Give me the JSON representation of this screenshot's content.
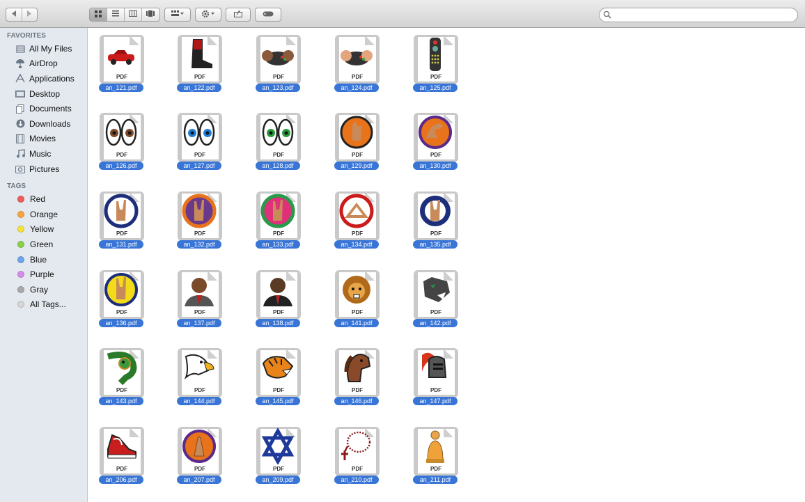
{
  "toolbar": {
    "back_icon": "chevron-left-icon",
    "forward_icon": "chevron-right-icon",
    "views": [
      "icon-view-icon",
      "list-view-icon",
      "column-view-icon",
      "coverflow-view-icon"
    ],
    "arrange_icon": "grid-arrange-icon",
    "action_icon": "gear-icon",
    "share_icon": "share-icon",
    "tags_icon": "tag-icon",
    "search_placeholder": ""
  },
  "sidebar": {
    "favorites_header": "FAVORITES",
    "favorites": [
      {
        "label": "All My Files",
        "icon": "all-files-icon"
      },
      {
        "label": "AirDrop",
        "icon": "airdrop-icon"
      },
      {
        "label": "Applications",
        "icon": "applications-icon"
      },
      {
        "label": "Desktop",
        "icon": "desktop-icon"
      },
      {
        "label": "Documents",
        "icon": "documents-icon"
      },
      {
        "label": "Downloads",
        "icon": "downloads-icon"
      },
      {
        "label": "Movies",
        "icon": "movies-icon"
      },
      {
        "label": "Music",
        "icon": "music-icon"
      },
      {
        "label": "Pictures",
        "icon": "pictures-icon"
      }
    ],
    "tags_header": "TAGS",
    "tags": [
      {
        "label": "Red",
        "color": "#f25c5c"
      },
      {
        "label": "Orange",
        "color": "#f8a541"
      },
      {
        "label": "Yellow",
        "color": "#f5e33d"
      },
      {
        "label": "Green",
        "color": "#8bd04b"
      },
      {
        "label": "Blue",
        "color": "#6ea6ee"
      },
      {
        "label": "Purple",
        "color": "#d48de8"
      },
      {
        "label": "Gray",
        "color": "#a9a9a9"
      },
      {
        "label": "All Tags...",
        "color": "#d6d6d6"
      }
    ]
  },
  "files": [
    {
      "name": "an_121.pdf",
      "icon": "red-car-icon"
    },
    {
      "name": "an_122.pdf",
      "icon": "red-boot-icon"
    },
    {
      "name": "an_123.pdf",
      "icon": "game-controller-dark-hands-icon"
    },
    {
      "name": "an_124.pdf",
      "icon": "game-controller-light-hands-icon"
    },
    {
      "name": "an_125.pdf",
      "icon": "tv-remote-icon"
    },
    {
      "name": "an_126.pdf",
      "icon": "brown-eyes-icon"
    },
    {
      "name": "an_127.pdf",
      "icon": "blue-eyes-icon"
    },
    {
      "name": "an_128.pdf",
      "icon": "green-eyes-icon"
    },
    {
      "name": "an_129.pdf",
      "icon": "hand-sign-orange-circle-icon"
    },
    {
      "name": "an_130.pdf",
      "icon": "flexed-arm-orange-circle-icon"
    },
    {
      "name": "an_131.pdf",
      "icon": "horns-hand-navy-ring-icon"
    },
    {
      "name": "an_132.pdf",
      "icon": "horns-hand-purple-orange-icon"
    },
    {
      "name": "an_133.pdf",
      "icon": "horns-hand-pink-green-icon"
    },
    {
      "name": "an_134.pdf",
      "icon": "triangle-hands-red-ring-icon"
    },
    {
      "name": "an_135.pdf",
      "icon": "horns-hand-navy-circle-icon"
    },
    {
      "name": "an_136.pdf",
      "icon": "horns-hand-yellow-circle-icon"
    },
    {
      "name": "an_137.pdf",
      "icon": "portrait-man-gray-suit-icon"
    },
    {
      "name": "an_138.pdf",
      "icon": "portrait-man-dark-suit-icon"
    },
    {
      "name": "an_141.pdf",
      "icon": "lion-mascot-icon"
    },
    {
      "name": "an_142.pdf",
      "icon": "panther-mascot-icon"
    },
    {
      "name": "an_143.pdf",
      "icon": "green-snake-icon"
    },
    {
      "name": "an_144.pdf",
      "icon": "eagle-mascot-icon"
    },
    {
      "name": "an_145.pdf",
      "icon": "tiger-mascot-icon"
    },
    {
      "name": "an_146.pdf",
      "icon": "horse-mascot-icon"
    },
    {
      "name": "an_147.pdf",
      "icon": "knight-helmet-icon"
    },
    {
      "name": "an_206.pdf",
      "icon": "red-sneaker-icon"
    },
    {
      "name": "an_207.pdf",
      "icon": "praying-hands-icon"
    },
    {
      "name": "an_209.pdf",
      "icon": "star-of-david-icon"
    },
    {
      "name": "an_210.pdf",
      "icon": "rosary-icon"
    },
    {
      "name": "an_211.pdf",
      "icon": "buddha-statue-icon"
    }
  ],
  "pdf_badge": "PDF"
}
